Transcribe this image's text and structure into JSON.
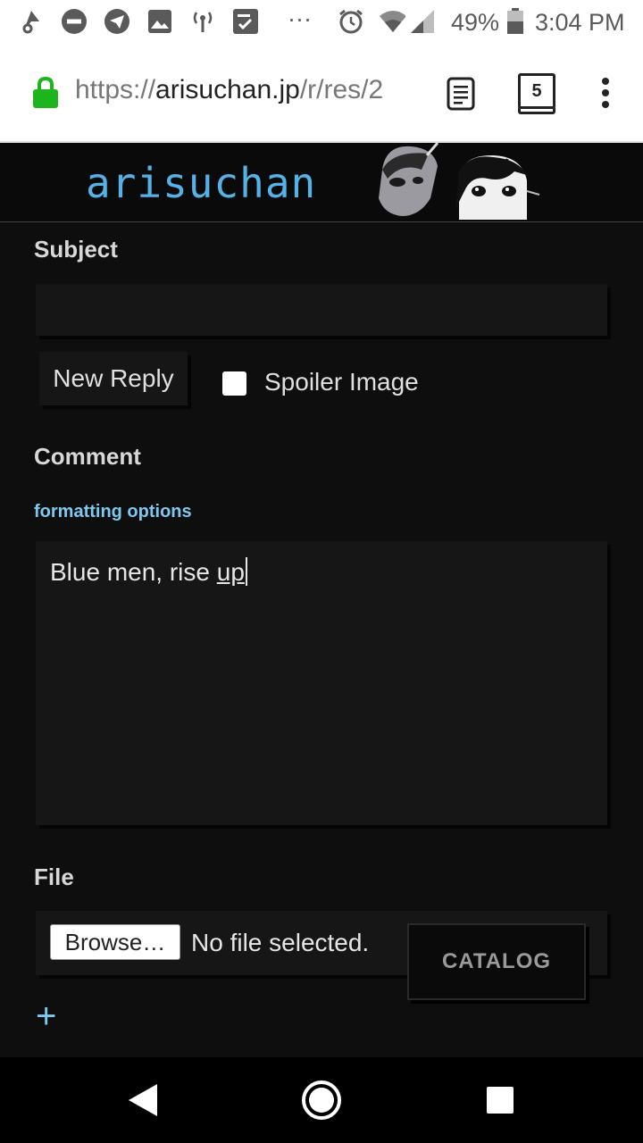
{
  "status_bar": {
    "battery_percent": "49%",
    "time": "3:04 PM",
    "overflow": "···",
    "icons": [
      "podcast-icon",
      "do-not-disturb-icon",
      "telegram-icon",
      "image-icon",
      "signal-tower-icon",
      "keep-notes-icon",
      "alarm-icon",
      "wifi-icon",
      "cell-signal-icon",
      "battery-icon"
    ]
  },
  "browser": {
    "url_scheme": "https://",
    "url_host": "arisuchan.jp",
    "url_path": "/r/res/2",
    "tab_count": "5",
    "secure_color": "#1db51d"
  },
  "site": {
    "title": "arisuchan",
    "title_color": "#55b2e6"
  },
  "form": {
    "subject_label": "Subject",
    "subject_value": "",
    "reply_button": "New Reply",
    "spoiler_label": "Spoiler Image",
    "spoiler_checked": false,
    "comment_label": "Comment",
    "formatting_link": "formatting options",
    "comment_value_plain": "Blue men, rise ",
    "comment_value_underlined": "up",
    "file_label": "File",
    "browse_button": "Browse…",
    "no_file_text": "No file selected.",
    "catalog_button": "CATALOG",
    "add_button": "+"
  }
}
